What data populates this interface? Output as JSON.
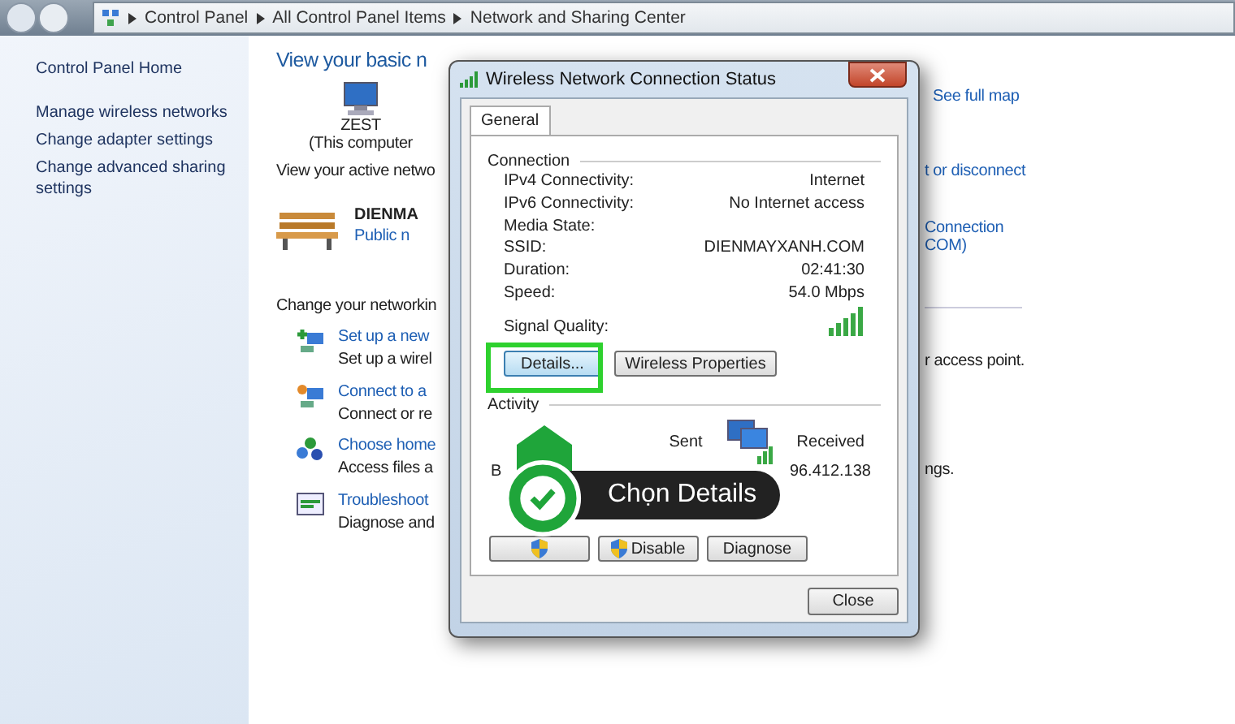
{
  "address_bar": {
    "crumbs": [
      "Control Panel",
      "All Control Panel Items",
      "Network and Sharing Center"
    ]
  },
  "sidebar": {
    "items": [
      {
        "label": "Control Panel Home"
      },
      {
        "label": "Manage wireless networks"
      },
      {
        "label": "Change adapter settings"
      },
      {
        "label": "Change advanced sharing settings"
      }
    ]
  },
  "main": {
    "heading": "View your basic n",
    "see_full_map": "See full map",
    "computer": {
      "name": "ZEST",
      "caption": "(This computer"
    },
    "active_label": "View your active netwo",
    "active_right": "t or disconnect",
    "network": {
      "name": "DIENMA",
      "type": "Public n",
      "connection_right": [
        "Connection",
        "COM)"
      ]
    },
    "change_label": "Change your networkin",
    "tasks": [
      {
        "kind": "setup",
        "title": "Set up a new",
        "desc": "Set up a wirel",
        "desc_right": "r access point."
      },
      {
        "kind": "connect",
        "title": "Connect to a",
        "desc": "Connect or re"
      },
      {
        "kind": "homegroup",
        "title": "Choose home",
        "desc": "Access files a",
        "desc_right": "ngs."
      },
      {
        "kind": "troubleshoot",
        "title": "Troubleshoot",
        "desc": "Diagnose and"
      }
    ]
  },
  "dialog": {
    "title": "Wireless Network Connection Status",
    "tabs": [
      {
        "label": "General",
        "selected": true
      }
    ],
    "connection_label": "Connection",
    "rows": [
      {
        "label": "IPv4 Connectivity:",
        "value": "Internet"
      },
      {
        "label": "IPv6 Connectivity:",
        "value": "No Internet access"
      },
      {
        "label": "Media State:"
      },
      {
        "label": "SSID:",
        "value": "DIENMAYXANH.COM"
      },
      {
        "label": "Duration:",
        "value": "02:41:30"
      },
      {
        "label": "Speed:",
        "value": "54.0 Mbps"
      }
    ],
    "signal_label": "Signal Quality:",
    "buttons": [
      "Details...",
      "Wireless Properties"
    ],
    "activity_label": "Activity",
    "sent_label": "Sent",
    "received_label": "Received",
    "bytes_label": "B",
    "bytes_received": "96.412.138",
    "action_buttons": [
      {
        "shield": true
      },
      {
        "label": "Disable",
        "shield": true
      },
      {
        "label": "Diagnose",
        "shield": false
      }
    ],
    "close_button": "Close"
  },
  "callout": {
    "text": "Chọn Details"
  }
}
